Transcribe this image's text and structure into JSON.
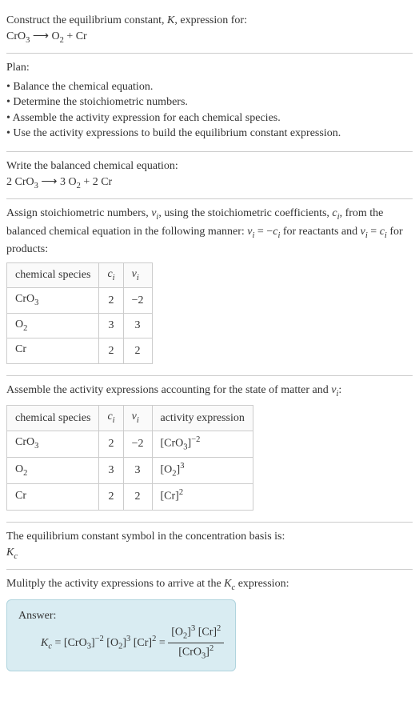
{
  "intro": {
    "line1_a": "Construct the equilibrium constant, ",
    "line1_K": "K",
    "line1_b": ", expression for:",
    "eq_lhs": "CrO",
    "eq_lhs_sub": "3",
    "arrow": " ⟶ ",
    "eq_rhs_a": "O",
    "eq_rhs_a_sub": "2",
    "eq_rhs_plus": " + Cr"
  },
  "plan": {
    "title": "Plan:",
    "items": [
      "Balance the chemical equation.",
      "Determine the stoichiometric numbers.",
      "Assemble the activity expression for each chemical species.",
      "Use the activity expressions to build the equilibrium constant expression."
    ]
  },
  "balanced": {
    "title": "Write the balanced chemical equation:",
    "c1": "2 CrO",
    "c1_sub": "3",
    "arrow": " ⟶ ",
    "c2": "3 O",
    "c2_sub": "2",
    "c3": " + 2 Cr"
  },
  "stoich": {
    "text_a": "Assign stoichiometric numbers, ",
    "nu_i": "ν",
    "i_sub": "i",
    "text_b": ", using the stoichiometric coefficients, ",
    "c_i": "c",
    "text_c": ", from the balanced chemical equation in the following manner: ",
    "rel1_a": "ν",
    "rel1_b": " = −",
    "rel1_c": "c",
    "text_d": " for reactants and ",
    "rel2_a": "ν",
    "rel2_b": " = ",
    "rel2_c": "c",
    "text_e": " for products:"
  },
  "table1": {
    "h1": "chemical species",
    "h2": "c",
    "h2_sub": "i",
    "h3": "ν",
    "h3_sub": "i",
    "rows": [
      {
        "sp_a": "CrO",
        "sp_sub": "3",
        "c": "2",
        "nu": "−2"
      },
      {
        "sp_a": "O",
        "sp_sub": "2",
        "c": "3",
        "nu": "3"
      },
      {
        "sp_a": "Cr",
        "sp_sub": "",
        "c": "2",
        "nu": "2"
      }
    ]
  },
  "assemble": {
    "text_a": "Assemble the activity expressions accounting for the state of matter and ",
    "nu": "ν",
    "nu_sub": "i",
    "text_b": ":"
  },
  "table2": {
    "h1": "chemical species",
    "h2": "c",
    "h2_sub": "i",
    "h3": "ν",
    "h3_sub": "i",
    "h4": "activity expression",
    "rows": [
      {
        "sp_a": "CrO",
        "sp_sub": "3",
        "c": "2",
        "nu": "−2",
        "act_base": "[CrO",
        "act_base_sub": "3",
        "act_close": "]",
        "act_exp": "−2"
      },
      {
        "sp_a": "O",
        "sp_sub": "2",
        "c": "3",
        "nu": "3",
        "act_base": "[O",
        "act_base_sub": "2",
        "act_close": "]",
        "act_exp": "3"
      },
      {
        "sp_a": "Cr",
        "sp_sub": "",
        "c": "2",
        "nu": "2",
        "act_base": "[Cr",
        "act_base_sub": "",
        "act_close": "]",
        "act_exp": "2"
      }
    ]
  },
  "ksymbol": {
    "line": "The equilibrium constant symbol in the concentration basis is:",
    "Kc_a": "K",
    "Kc_sub": "c"
  },
  "multiply": {
    "text_a": "Mulitply the activity expressions to arrive at the ",
    "Kc_a": "K",
    "Kc_sub": "c",
    "text_b": " expression:"
  },
  "answer": {
    "label": "Answer:",
    "Kc_a": "K",
    "Kc_sub": "c",
    "eq": " = ",
    "t1_a": "[CrO",
    "t1_sub": "3",
    "t1_close": "]",
    "t1_exp": "−2",
    "sp": " ",
    "t2_a": "[O",
    "t2_sub": "2",
    "t2_close": "]",
    "t2_exp": "3",
    "t3_a": "[Cr]",
    "t3_exp": "2",
    "eq2": " = ",
    "num_a": "[O",
    "num_a_sub": "2",
    "num_a_close": "]",
    "num_a_exp": "3",
    "num_b": " [Cr]",
    "num_b_exp": "2",
    "den_a": "[CrO",
    "den_a_sub": "3",
    "den_a_close": "]",
    "den_a_exp": "2"
  }
}
